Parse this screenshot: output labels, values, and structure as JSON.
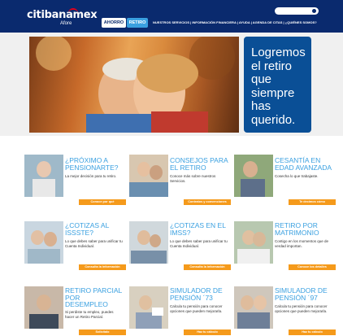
{
  "brand": {
    "logo": "citibanamex",
    "sub": "Afore"
  },
  "header": {
    "tabs": [
      "AHORRO",
      "RETIRO"
    ],
    "nav_text": "NUESTROS SERVICIOS  |  INFORMACIÓN FINANCIERA  |  AYUDA  |  AGENDA DE CITAS  |  ¿QUIÉNES SOMOS?"
  },
  "hero": {
    "text": "Logremos el retiro que siempre has querido."
  },
  "cards": [
    {
      "title": "¿PRÓXIMO A PENSIONARTE?",
      "desc": "La mejor decisión para tu retiro.",
      "button": "Conoce por qué"
    },
    {
      "title": "CONSEJOS PARA EL RETIRO",
      "desc": "Conoce más sobre nuestros Servicios.",
      "button": "Contratos y convenciones"
    },
    {
      "title": "CESANTÍA EN EDAD AVANZADA",
      "desc": "Cosecha lo que trabajaste.",
      "button": "Te decimos cómo"
    },
    {
      "title": "¿COTIZAS AL ISSSTE?",
      "desc": "Lo que debes saber para unificar tu Cuenta Individual.",
      "button": "Consulta la información"
    },
    {
      "title": "¿COTIZAS EN EL IMSS?",
      "desc": "Lo que debes saber para unificar tu Cuenta Individual.",
      "button": "Consulta la información"
    },
    {
      "title": "RETIRO POR MATRIMONIO",
      "desc": "Contigo en los momentos que de verdad importan.",
      "button": "Conoce los detalles"
    },
    {
      "title": "RETIRO PARCIAL POR DESEMPLEO",
      "desc": "Si perdiste tu empleo, puedes hacer un Retiro Parcial.",
      "button": "Solicítalo"
    },
    {
      "title": "SIMULADOR DE PENSIÓN ´73",
      "desc": "Calcula tu pensión para conocer opciones que pueden mejorarla.",
      "button": "Haz tu cálculo"
    },
    {
      "title": "SIMULADOR DE PENSIÓN ´97",
      "desc": "Calcula tu pensión para conocer opciones que pueden mejorarla.",
      "button": "Haz tu cálculo"
    }
  ],
  "colors": {
    "navy": "#0a2a6e",
    "accent_blue": "#3aa0e0",
    "orange": "#f59a1b",
    "hero_card": "#0a4f96",
    "logo_red": "#e3001b"
  }
}
